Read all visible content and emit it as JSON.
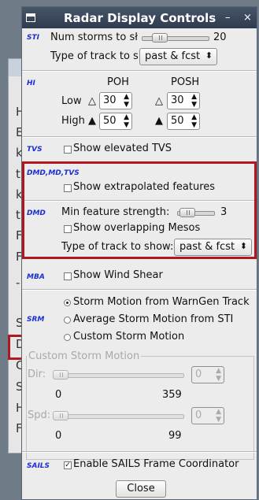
{
  "background": {
    "letters": [
      "H",
      "E",
      "k",
      "t",
      "k",
      "t",
      "F",
      "F",
      "-",
      "S",
      "D",
      "C",
      "S",
      "H",
      "F"
    ]
  },
  "window": {
    "title": "Radar Display Controls",
    "minimize": "–",
    "close": "×"
  },
  "sti": {
    "label": "STI",
    "num_storms_label": "Num storms to sł",
    "num_storms_value": "20",
    "track_type_label": "Type of track to s",
    "track_type_value": "past & fcst"
  },
  "hi": {
    "label": "HI",
    "poh_header": "POH",
    "posh_header": "POSH",
    "low_label": "Low",
    "high_label": "High",
    "poh_low": "30",
    "posh_low": "30",
    "poh_high": "50",
    "posh_high": "50"
  },
  "tvs": {
    "label": "TVS",
    "show_elevated": "Show elevated TVS",
    "checked": false
  },
  "dmd_md_tvs": {
    "label": "DMD,MD,TVS",
    "show_extrapolated": "Show extrapolated features",
    "checked": false
  },
  "dmd": {
    "label": "DMD",
    "min_strength_label": "Min feature strength:",
    "min_strength_value": "3",
    "show_overlapping": "Show overlapping Mesos",
    "overlapping_checked": false,
    "track_type_label": "Type of track to show:",
    "track_type_value": "past & fcst"
  },
  "mba": {
    "label": "MBA",
    "show_wind_shear": "Show Wind Shear",
    "checked": false
  },
  "srm": {
    "label": "SRM",
    "options": [
      {
        "label": "Storm Motion from WarnGen Track",
        "selected": true
      },
      {
        "label": "Average Storm Motion from STI",
        "selected": false
      },
      {
        "label": "Custom Storm Motion",
        "selected": false
      }
    ],
    "custom_group_title": "Custom Storm Motion",
    "dir_label": "Dir:",
    "dir_value": "0",
    "dir_min": "0",
    "dir_max": "359",
    "spd_label": "Spd:",
    "spd_value": "0",
    "spd_min": "0",
    "spd_max": "99"
  },
  "sails": {
    "label": "SAILS",
    "enable": "Enable SAILS Frame Coordinator",
    "checked": true
  },
  "close_button": "Close",
  "colors": {
    "title_bar": "#3b4a5f",
    "section_label": "#1a2fd1",
    "highlight_box": "#b0171f"
  }
}
